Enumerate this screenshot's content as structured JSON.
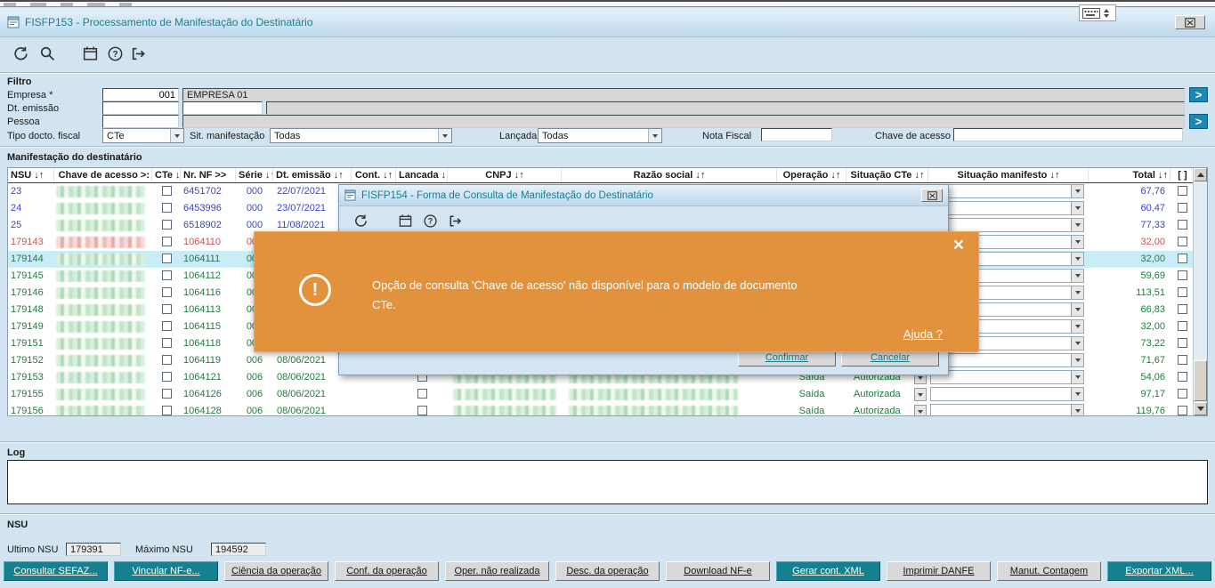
{
  "window": {
    "title": "FISFP153 - Processamento de Manifestação do Destinatário"
  },
  "icons": {
    "refresh": "circular-arrow",
    "search": "magnifier",
    "calendar": "calendar",
    "help": "question-mark",
    "exit": "exit-arrow",
    "keyboard": "keyboard",
    "sort": "↓↑",
    "chevron": ">",
    "close": "×",
    "dropdown": "▼",
    "warning": "!"
  },
  "colors": {
    "teal_accent": "#15808f",
    "alert_orange": "#e2923c",
    "title_text": "#1a7f8e",
    "row_blue": "#3b43cf",
    "row_green": "#1c7e3e",
    "row_red": "#d34f4f",
    "selected_row": "#c9edf6"
  },
  "filter": {
    "section_label": "Filtro",
    "empresa": {
      "label": "Empresa *",
      "code": "001",
      "name": "EMPRESA 01"
    },
    "dt_emissao": {
      "label": "Dt. emissão",
      "value1": "",
      "value2": ""
    },
    "pessoa": {
      "label": "Pessoa",
      "value": ""
    },
    "tipo_docto": {
      "label": "Tipo docto. fiscal",
      "value": "CTe"
    },
    "sit_manifestacao": {
      "label": "Sit. manifestação",
      "value": "Todas"
    },
    "lancada": {
      "label": "Lançada",
      "value": "Todas"
    },
    "nota_fiscal": {
      "label": "Nota Fiscal",
      "value": ""
    },
    "chave_acesso": {
      "label": "Chave de acesso",
      "value": ""
    }
  },
  "grid": {
    "section_label": "Manifestação do destinatário",
    "columns": [
      {
        "label": "NSU",
        "sort": true
      },
      {
        "label": "Chave de acesso >:",
        "sort": false
      },
      {
        "label": "CTe",
        "sort": true
      },
      {
        "label": "Nr. NF >>",
        "sort": false
      },
      {
        "label": "Série",
        "sort": true
      },
      {
        "label": "Dt. emissão",
        "sort": true
      },
      {
        "label": "Cont.",
        "sort": true
      },
      {
        "label": "Lancada",
        "sort": true
      },
      {
        "label": "CNPJ",
        "sort": true
      },
      {
        "label": "Razão social",
        "sort": true
      },
      {
        "label": "Operação",
        "sort": true
      },
      {
        "label": "Situação CTe",
        "sort": true
      },
      {
        "label": "Situação manifesto",
        "sort": true
      },
      {
        "label": "Total",
        "sort": true
      },
      {
        "label": "[ ]",
        "sort": false
      }
    ],
    "rows": [
      {
        "nsu": "23",
        "nr_nf": "6451702",
        "serie": "000",
        "dt_emissao": "22/07/2021",
        "operacao": "",
        "situacao_cte": "",
        "total": "67,76",
        "tone": "blue",
        "selected": false,
        "lancada_checkbox": false,
        "cnpj_redacted": false
      },
      {
        "nsu": "24",
        "nr_nf": "6453996",
        "serie": "000",
        "dt_emissao": "23/07/2021",
        "operacao": "",
        "situacao_cte": "",
        "total": "60,47",
        "tone": "blue",
        "selected": false,
        "lancada_checkbox": false,
        "cnpj_redacted": false
      },
      {
        "nsu": "25",
        "nr_nf": "6518902",
        "serie": "000",
        "dt_emissao": "11/08/2021",
        "operacao": "",
        "situacao_cte": "",
        "total": "77,33",
        "tone": "blue",
        "selected": false,
        "lancada_checkbox": false,
        "cnpj_redacted": false
      },
      {
        "nsu": "179143",
        "nr_nf": "1064110",
        "serie": "006",
        "dt_emissao": "",
        "operacao": "",
        "situacao_cte": "",
        "total": "32,00",
        "tone": "red",
        "selected": false,
        "lancada_checkbox": false,
        "cnpj_redacted": false
      },
      {
        "nsu": "179144",
        "nr_nf": "1064111",
        "serie": "006",
        "dt_emissao": "",
        "operacao": "",
        "situacao_cte": "",
        "total": "32,00",
        "tone": "green",
        "selected": true,
        "lancada_checkbox": false,
        "cnpj_redacted": false
      },
      {
        "nsu": "179145",
        "nr_nf": "1064112",
        "serie": "006",
        "dt_emissao": "",
        "operacao": "",
        "situacao_cte": "",
        "total": "59,69",
        "tone": "green",
        "selected": false,
        "lancada_checkbox": false,
        "cnpj_redacted": false
      },
      {
        "nsu": "179146",
        "nr_nf": "1064116",
        "serie": "006",
        "dt_emissao": "",
        "operacao": "",
        "situacao_cte": "",
        "total": "113,51",
        "tone": "green",
        "selected": false,
        "lancada_checkbox": false,
        "cnpj_redacted": false
      },
      {
        "nsu": "179148",
        "nr_nf": "1064113",
        "serie": "006",
        "dt_emissao": "",
        "operacao": "",
        "situacao_cte": "",
        "total": "66,83",
        "tone": "green",
        "selected": false,
        "lancada_checkbox": false,
        "cnpj_redacted": false
      },
      {
        "nsu": "179149",
        "nr_nf": "1064115",
        "serie": "006",
        "dt_emissao": "",
        "operacao": "",
        "situacao_cte": "",
        "total": "32,00",
        "tone": "green",
        "selected": false,
        "lancada_checkbox": false,
        "cnpj_redacted": false
      },
      {
        "nsu": "179151",
        "nr_nf": "1064118",
        "serie": "006",
        "dt_emissao": "",
        "operacao": "",
        "situacao_cte": "",
        "total": "73,22",
        "tone": "green",
        "selected": false,
        "lancada_checkbox": false,
        "cnpj_redacted": false
      },
      {
        "nsu": "179152",
        "nr_nf": "1064119",
        "serie": "006",
        "dt_emissao": "08/06/2021",
        "operacao": "",
        "situacao_cte": "",
        "total": "71,67",
        "tone": "green",
        "selected": false,
        "lancada_checkbox": false,
        "cnpj_redacted": false
      },
      {
        "nsu": "179153",
        "nr_nf": "1064121",
        "serie": "006",
        "dt_emissao": "08/06/2021",
        "operacao": "Saída",
        "situacao_cte": "Autorizada",
        "total": "54,06",
        "tone": "green",
        "selected": false,
        "lancada_checkbox": true,
        "cnpj_redacted": true
      },
      {
        "nsu": "179155",
        "nr_nf": "1064126",
        "serie": "006",
        "dt_emissao": "08/06/2021",
        "operacao": "Saída",
        "situacao_cte": "Autorizada",
        "total": "97,17",
        "tone": "green",
        "selected": false,
        "lancada_checkbox": true,
        "cnpj_redacted": true
      },
      {
        "nsu": "179156",
        "nr_nf": "1064128",
        "serie": "006",
        "dt_emissao": "08/06/2021",
        "operacao": "Saída",
        "situacao_cte": "Autorizada",
        "total": "119,76",
        "tone": "green",
        "selected": false,
        "lancada_checkbox": true,
        "cnpj_redacted": true
      }
    ]
  },
  "dialog": {
    "title": "FISFP154 - Forma de Consulta de Manifestação do Destinatário",
    "buttons": {
      "confirm": "Confirmar",
      "cancel": "Cancelar"
    }
  },
  "alert": {
    "message_lines": [
      "Opção de consulta 'Chave de acesso' não disponível para o modelo de documento",
      "CTe."
    ],
    "help_link": "Ajuda ?"
  },
  "log": {
    "section_label": "Log",
    "content": ""
  },
  "nsu": {
    "section_label": "NSU",
    "ultimo_label": "Ultimo NSU",
    "ultimo_value": "179391",
    "maximo_label": "Máximo NSU",
    "maximo_value": "194592"
  },
  "actions": [
    {
      "label": "Consultar SEFAZ...",
      "style": "teal"
    },
    {
      "label": "Vincular NF-e...",
      "style": "teal"
    },
    {
      "label": "Ciência da operação",
      "style": "gray"
    },
    {
      "label": "Conf. da operação",
      "style": "gray"
    },
    {
      "label": "Oper. não realizada",
      "style": "gray"
    },
    {
      "label": "Desc. da operação",
      "style": "gray"
    },
    {
      "label": "Download NF-e",
      "style": "gray"
    },
    {
      "label": "Gerar cont. XML",
      "style": "teal"
    },
    {
      "label": "Imprimir DANFE",
      "style": "gray"
    },
    {
      "label": "Manut. Contagem",
      "style": "gray"
    },
    {
      "label": "Exportar XML...",
      "style": "teal"
    }
  ]
}
